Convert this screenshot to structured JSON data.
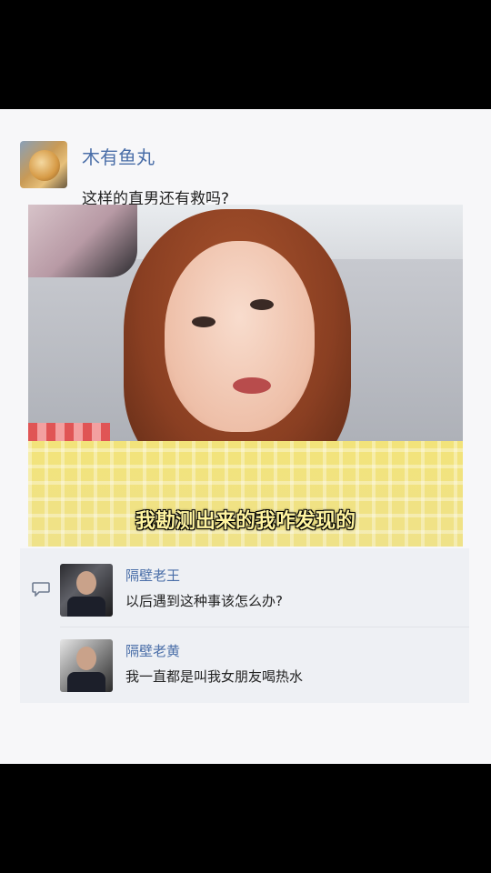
{
  "post": {
    "username": "木有鱼丸",
    "text": "这样的直男还有救吗?",
    "media": {
      "caption": "我勘测出来的我咋发现的"
    }
  },
  "comments": [
    {
      "author": "隔壁老王",
      "text": "以后遇到这种事该怎么办?"
    },
    {
      "author": "隔壁老黄",
      "text": "我一直都是叫我女朋友喝热水"
    }
  ],
  "icons": {
    "comment": "comment-bubble-icon"
  },
  "colors": {
    "name": "#4a6ea8",
    "caption": "#fff4a0"
  }
}
